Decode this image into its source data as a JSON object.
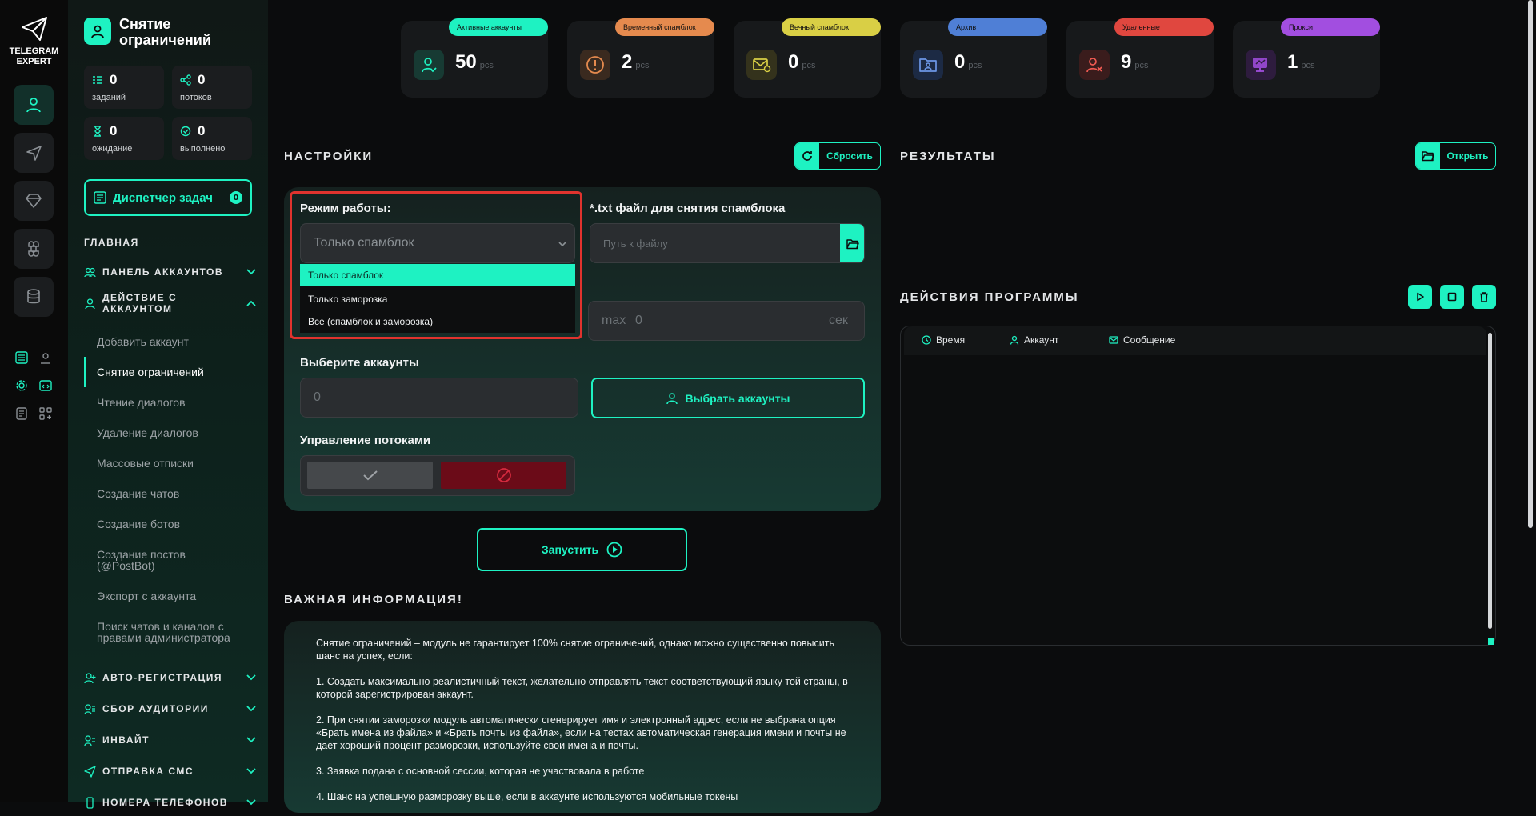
{
  "rail": {
    "logo_text": "TELEGRAM\nEXPERT",
    "icons": [
      "user-icon",
      "send-icon",
      "diamond-icon",
      "command-icon",
      "database-icon"
    ]
  },
  "sidebar": {
    "title": "Снятие ограничений",
    "stats": [
      {
        "value": "0",
        "label": "заданий",
        "icon": "tasks-icon"
      },
      {
        "value": "0",
        "label": "потоков",
        "icon": "share-icon"
      },
      {
        "value": "0",
        "label": "ожидание",
        "icon": "hourglass-icon"
      },
      {
        "value": "0",
        "label": "выполнено",
        "icon": "check-circle-icon"
      }
    ],
    "dispatcher": {
      "label": "Диспетчер задач",
      "count": "0"
    },
    "main_label": "ГЛАВНАЯ",
    "groups": [
      {
        "label": "ПАНЕЛЬ АККАУНТОВ"
      },
      {
        "label": "ДЕЙСТВИЕ С АККАУНТОМ"
      },
      {
        "label": "АВТО-РЕГИСТРАЦИЯ"
      },
      {
        "label": "СБОР АУДИТОРИИ"
      },
      {
        "label": "ИНВАЙТ"
      },
      {
        "label": "ОТПРАВКА СМС"
      },
      {
        "label": "НОМЕРА ТЕЛЕФОНОВ"
      }
    ],
    "items": [
      "Добавить аккаунт",
      "Снятие ограничений",
      "Чтение диалогов",
      "Удаление диалогов",
      "Массовые отписки",
      "Создание чатов",
      "Создание ботов",
      "Создание постов (@PostBot)",
      "Экспорт с аккаунта",
      "Поиск чатов и каналов с правами администратора"
    ]
  },
  "cards": [
    {
      "label": "Активные аккаунты",
      "value": "50",
      "unit": "pcs",
      "color": "#1ef2c2"
    },
    {
      "label": "Временный спамблок",
      "value": "2",
      "unit": "pcs",
      "color": "#e58a4e"
    },
    {
      "label": "Вечный спамблок",
      "value": "0",
      "unit": "pcs",
      "color": "#d9cf45"
    },
    {
      "label": "Архив",
      "value": "0",
      "unit": "pcs",
      "color": "#4f7fd6"
    },
    {
      "label": "Удаленные",
      "value": "9",
      "unit": "pcs",
      "color": "#e0473f"
    },
    {
      "label": "Прокси",
      "value": "1",
      "unit": "pcs",
      "color": "#a24ee0"
    }
  ],
  "settings": {
    "title": "НАСТРОЙКИ",
    "reset": "Сбросить",
    "mode_label": "Режим работы:",
    "mode_value": "Только спамблок",
    "mode_options": [
      "Только спамблок",
      "Только заморозка",
      "Все (спамблок и заморозка)"
    ],
    "file_label": "*.txt файл для снятия спамблока",
    "file_placeholder": "Путь к файлу",
    "max_label": "max",
    "max_value": "0",
    "max_unit": "сек",
    "accounts_label": "Выберите аккаунты",
    "accounts_value": "0",
    "choose_accounts": "Выбрать аккаунты",
    "threads_label": "Управление потоками",
    "run": "Запустить"
  },
  "results": {
    "title": "РЕЗУЛЬТАТЫ",
    "open": "Открыть",
    "actions_title": "ДЕЙСТВИЯ ПРОГРАММЫ",
    "columns": [
      "Время",
      "Аккаунт",
      "Сообщение"
    ]
  },
  "info": {
    "title": "ВАЖНАЯ ИНФОРМАЦИЯ!",
    "paragraphs": [
      "Снятие ограничений – модуль не гарантирует 100% снятие ограничений, однако можно существенно повысить шанс на успех, если:",
      "1. Создать максимально реалистичный текст, желательно отправлять текст соответствующий языку той страны, в которой зарегистрирован аккаунт.",
      "2. При снятии заморозки модуль автоматически сгенерирует имя и электронный адрес, если не выбрана опция «Брать имена из файла» и «Брать почты из файла», если на тестах автоматическая генерация имени и почты не дает хороший процент разморозки, используйте свои имена и почты.",
      "3. Заявка подана с основной сессии, которая не участвовала в работе",
      "4. Шанс на успешную разморозку выше, если в аккаунте используются мобильные токены"
    ]
  }
}
